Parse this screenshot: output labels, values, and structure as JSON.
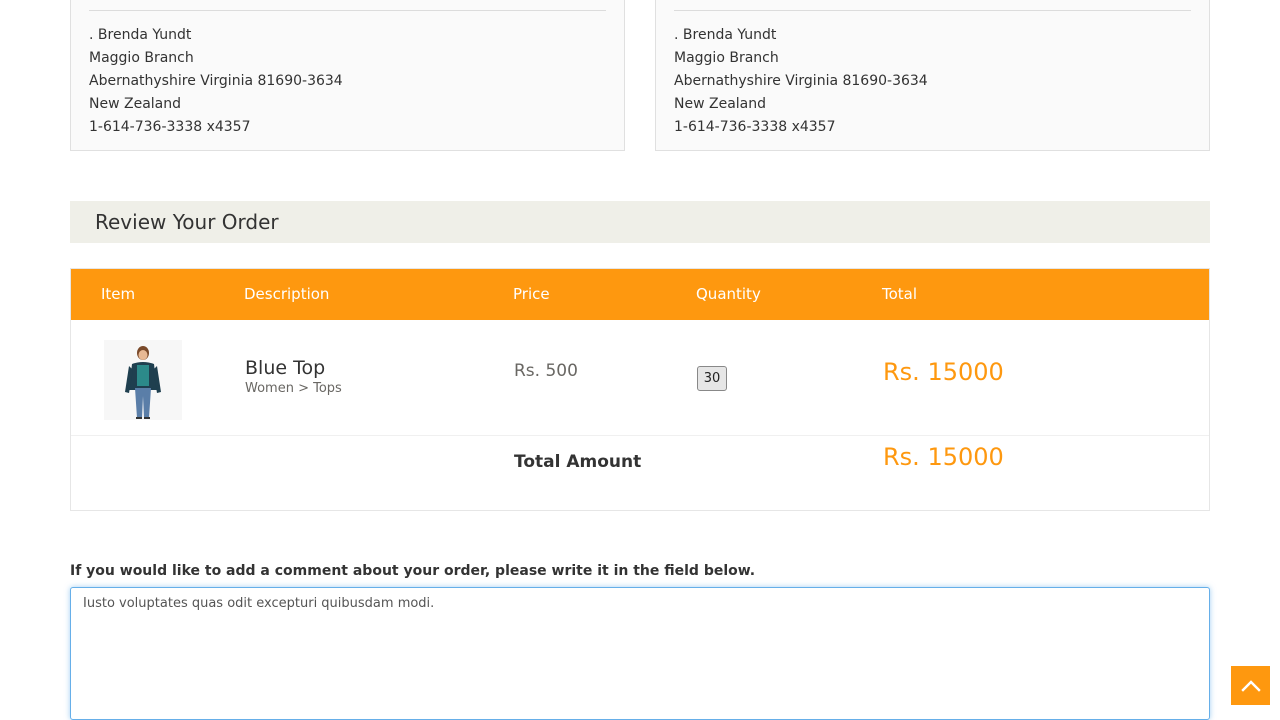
{
  "delivery_address": {
    "lines": [
      ". Brenda Yundt",
      "Maggio Branch",
      "Abernathyshire Virginia 81690-3634",
      "New Zealand",
      "1-614-736-3338 x4357"
    ]
  },
  "billing_address": {
    "lines": [
      ". Brenda Yundt",
      "Maggio Branch",
      "Abernathyshire Virginia 81690-3634",
      "New Zealand",
      "1-614-736-3338 x4357"
    ]
  },
  "review": {
    "heading": "Review Your Order"
  },
  "table": {
    "headers": [
      "Item",
      "Description",
      "Price",
      "Quantity",
      "Total"
    ],
    "rows": [
      {
        "name": "Blue Top",
        "category": "Women > Tops",
        "price": "Rs. 500",
        "quantity": "30",
        "total": "Rs. 15000"
      }
    ],
    "total_label": "Total Amount",
    "total_amount": "Rs. 15000"
  },
  "comment": {
    "label": "If you would like to add a comment about your order, please write it in the field below.",
    "value": "Iusto voluptates quas odit excepturi quibusdam modi."
  },
  "colors": {
    "accent": "#fe980f",
    "heading_bg": "#efefe8"
  },
  "icons": {
    "scroll_up": "chevron-up-icon"
  }
}
